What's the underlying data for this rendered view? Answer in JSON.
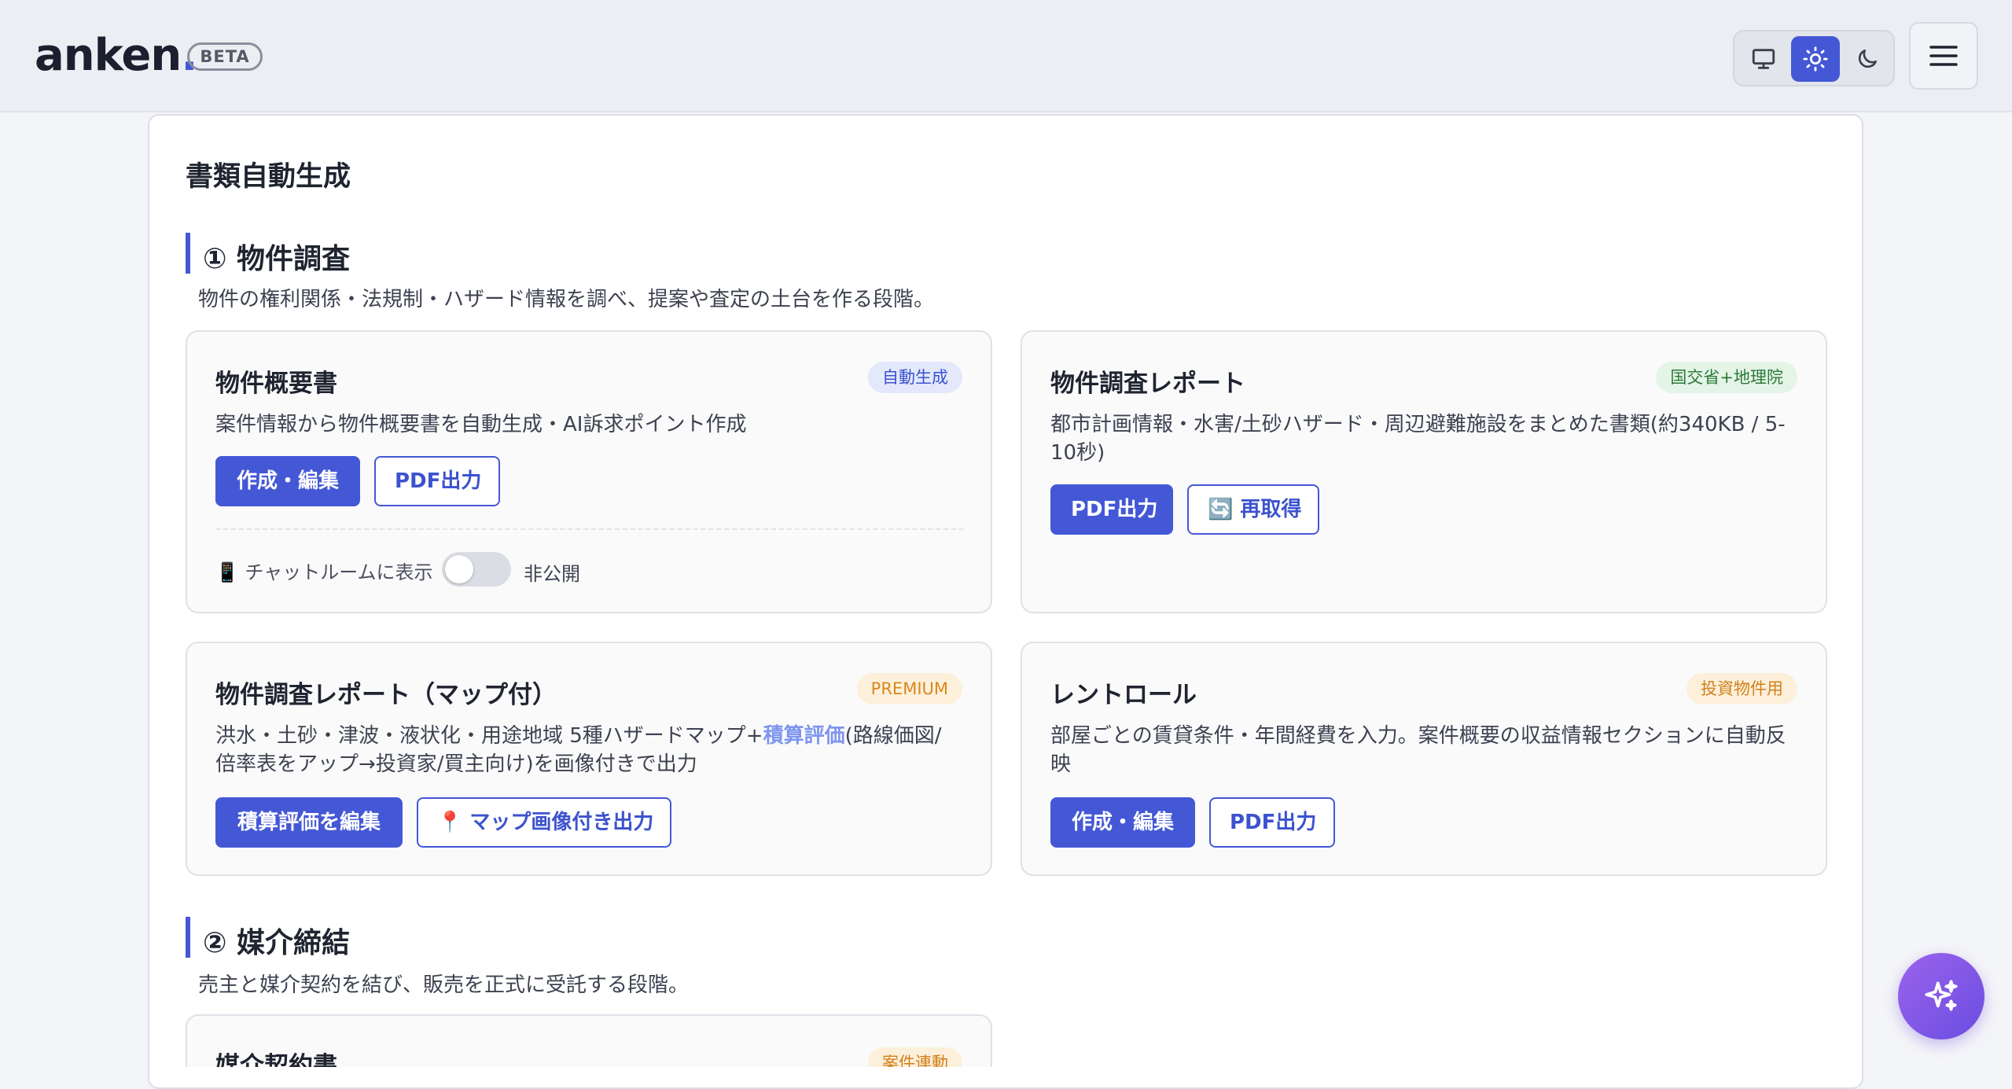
{
  "header": {
    "logo_text": "anken",
    "logo_dot": ".",
    "beta_label": "BETA",
    "theme_options": [
      "monitor-icon",
      "sun-icon",
      "moon-icon"
    ],
    "active_theme": "sun-icon"
  },
  "page": {
    "title": "書類自動生成"
  },
  "sections": [
    {
      "title": "① 物件調査",
      "description": "物件の権利関係・法規制・ハザード情報を調べ、提案や査定の土台を作る段階。",
      "cards": [
        {
          "title": "物件概要書",
          "badge": "自動生成",
          "description": "案件情報から物件概要書を自動生成・AI訴求ポイント作成",
          "buttons": [
            "作成・編集",
            "PDF出力"
          ],
          "toggle_label": "📱 チャットルームに表示",
          "toggle_state": "非公開"
        },
        {
          "title": "物件調査レポート",
          "badge": "国交省+地理院",
          "description_line1": "都市計画情報・水害/土砂ハザード・周辺避難施設をまとめた書類(約340KB / 5-",
          "description_line2": "10秒)",
          "buttons": [
            "PDF出力",
            "🔄 再取得"
          ]
        },
        {
          "title": "物件調査レポート（マップ付）",
          "badge": "PREMIUM",
          "description_pre": "洪水・土砂・津波・液状化・用途地域 5種ハザードマップ+",
          "description_highlight": "積算評価",
          "description_post": "(路線価図/",
          "description_line2": "倍率表をアップ→投資家/買主向け)を画像付きで出力",
          "buttons": [
            "積算評価を編集",
            "📍 マップ画像付き出力"
          ]
        },
        {
          "title": "レントロール",
          "badge": "投資物件用",
          "description_line1": "部屋ごとの賃貸条件・年間経費を入力。案件概要の収益情報セクションに自動反",
          "description_line2": "映",
          "buttons": [
            "作成・編集",
            "PDF出力"
          ]
        }
      ]
    },
    {
      "title": "② 媒介締結",
      "description": "売主と媒介契約を結び、販売を正式に受託する段階。",
      "cards": [
        {
          "title": "媒介契約書",
          "badge": "案件連動"
        }
      ]
    }
  ],
  "colors": {
    "accent": "#4458d6",
    "fab_gradient_start": "#9b63ec",
    "fab_gradient_end": "#6a4de0"
  },
  "fab": {
    "icon": "sparkles-icon"
  }
}
